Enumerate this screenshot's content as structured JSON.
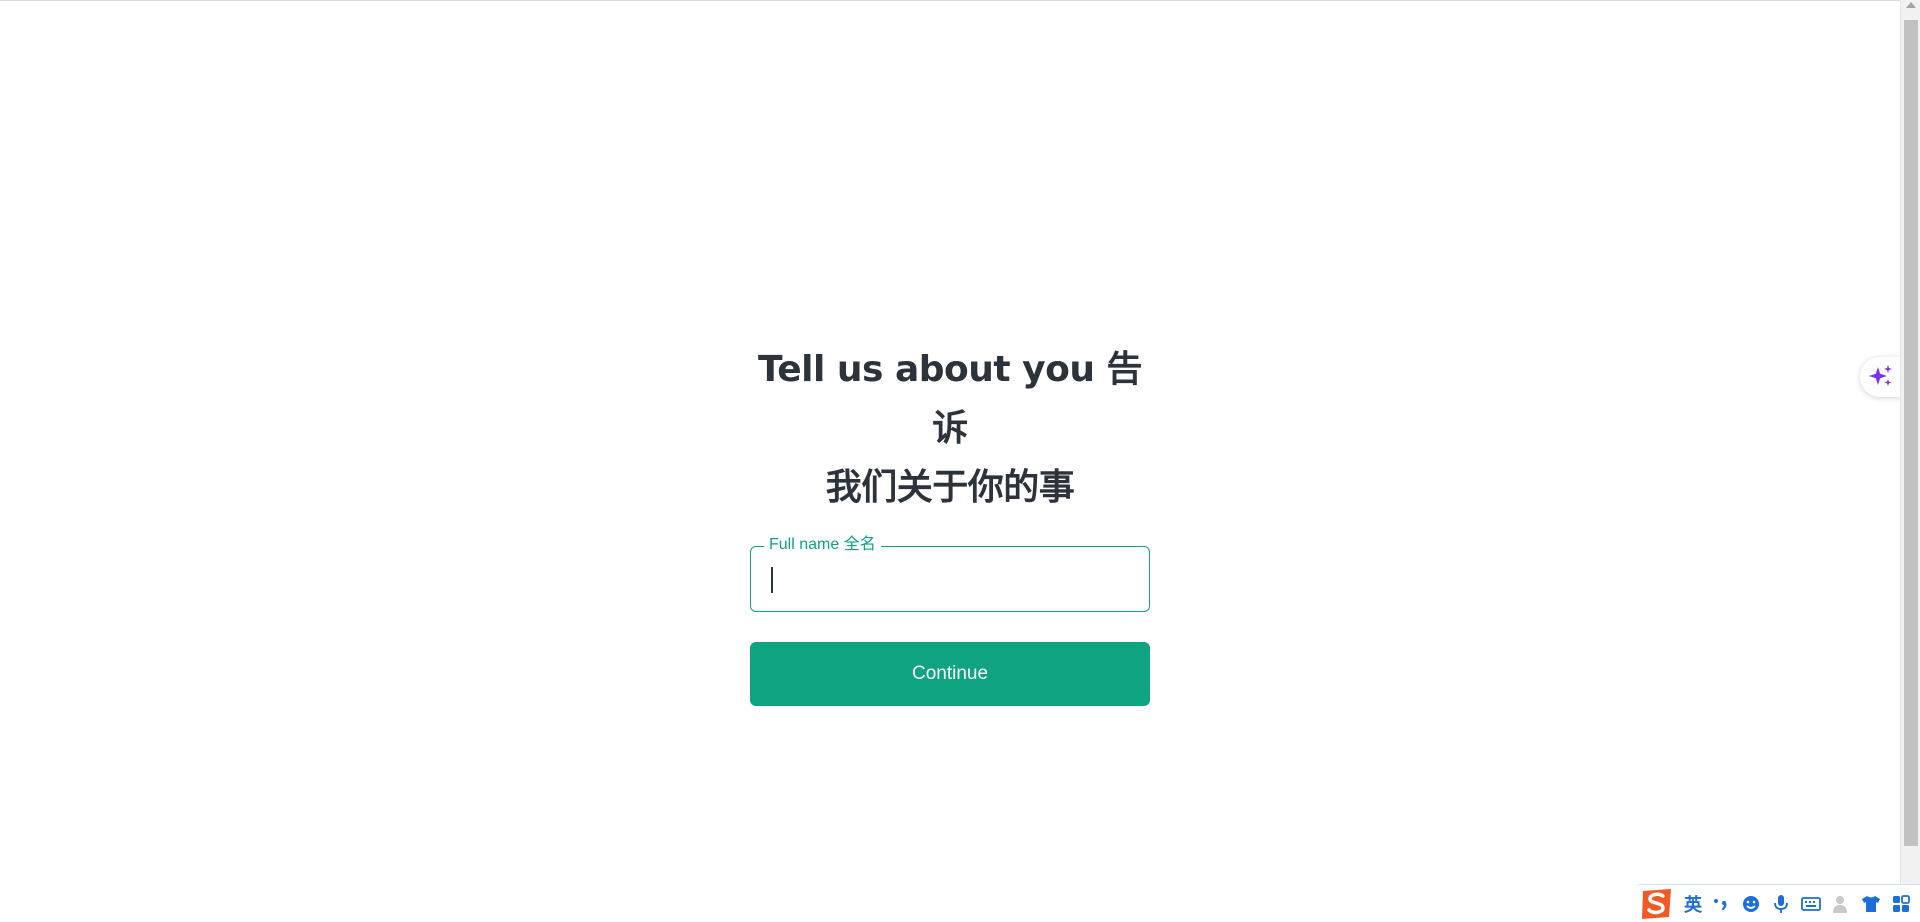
{
  "heading": {
    "line1": "Tell us about you 告诉",
    "line2": "我们关于你的事"
  },
  "name_field": {
    "label": "Full name 全名",
    "value": ""
  },
  "continue_button": {
    "label": "Continue"
  },
  "ime_toolbar": {
    "language": "英",
    "icons": [
      "sogou-logo-icon",
      "punctuation-icon",
      "emoji-icon",
      "microphone-icon",
      "keyboard-icon",
      "user-icon",
      "skin-icon",
      "toolbox-icon"
    ]
  },
  "colors": {
    "accent": "#10a37f",
    "heading": "#2d333a",
    "sparkle": "#7b2ff7",
    "ime_blue": "#1b6fd6",
    "ime_logo": "#f05a24"
  }
}
